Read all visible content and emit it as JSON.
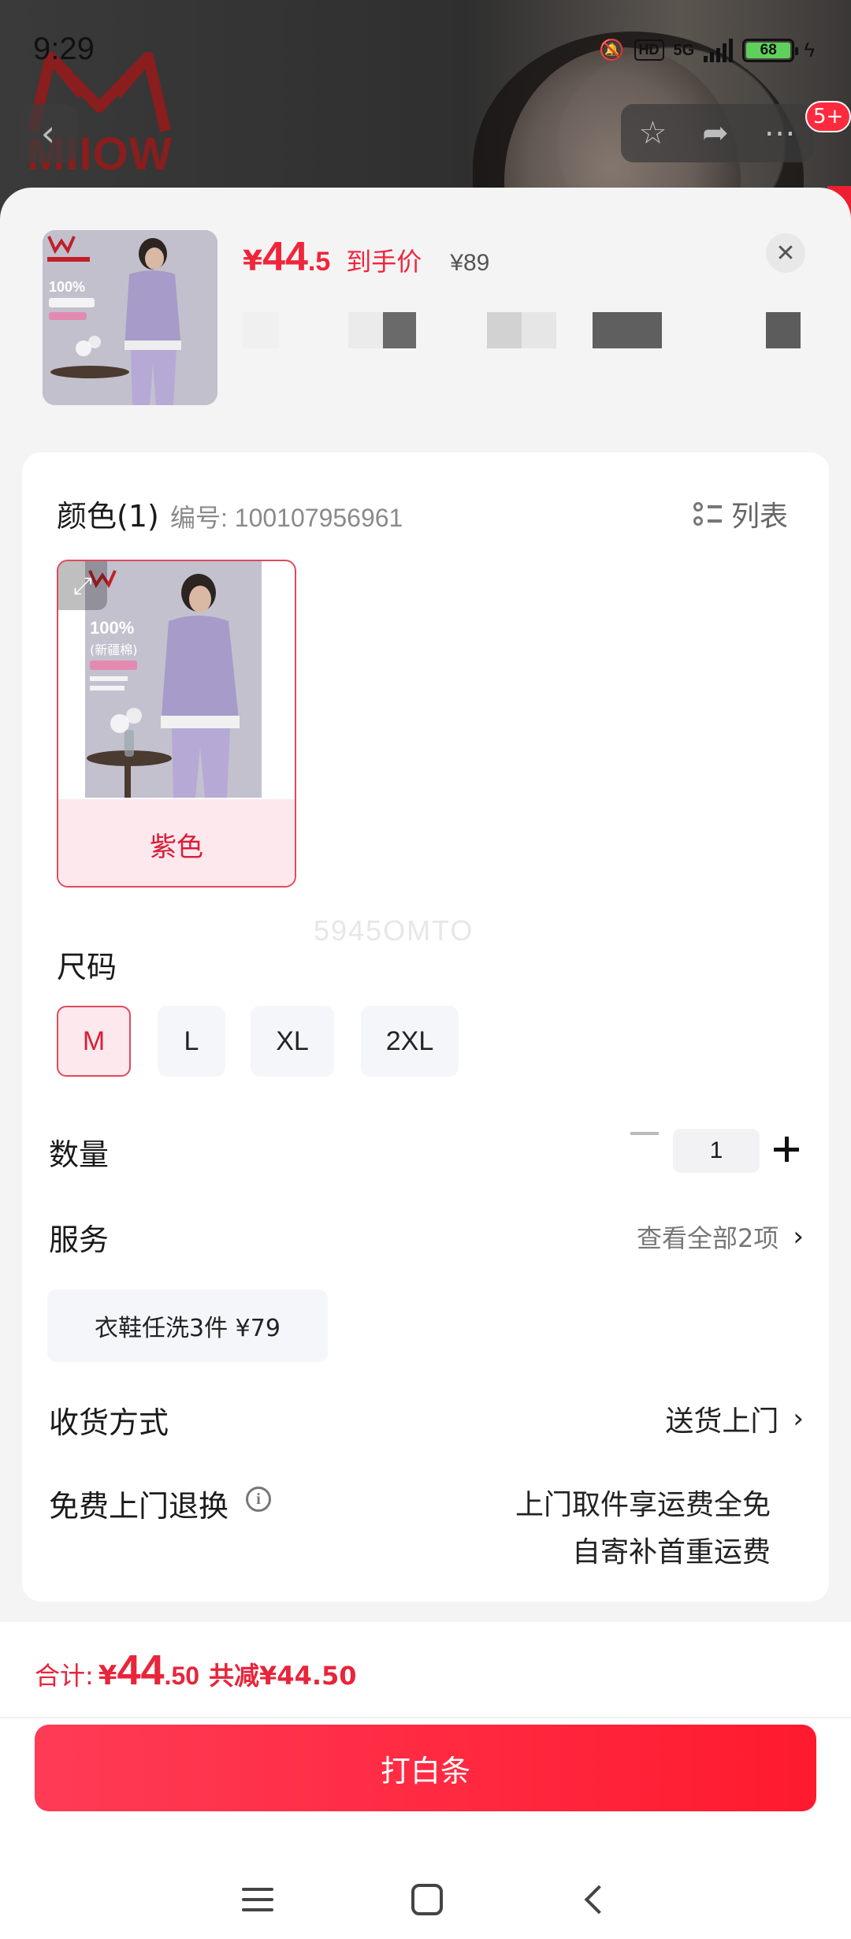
{
  "status_bar": {
    "time": "9:29",
    "hd": "HD",
    "network": "5G",
    "battery_level": "68",
    "battery_color": "#5fd15a"
  },
  "brand": {
    "word": "MIIOW"
  },
  "header": {
    "back_icon": "chevron-left-icon",
    "actions": [
      "star-icon",
      "share-icon",
      "more-icon"
    ],
    "badge": "5+"
  },
  "product": {
    "price_symbol": "¥",
    "price_int": "44",
    "price_dec": ".5",
    "price_label": "到手价",
    "original_price": "¥89"
  },
  "color": {
    "title": "颜色(1)",
    "code": "编号: 100107956961",
    "view_toggle": "列表",
    "options": [
      {
        "label": "紫色",
        "selected": true
      }
    ]
  },
  "watermark": "5945OMTO",
  "size": {
    "title": "尺码",
    "options": [
      {
        "label": "M",
        "selected": true
      },
      {
        "label": "L",
        "selected": false
      },
      {
        "label": "XL",
        "selected": false
      },
      {
        "label": "2XL",
        "selected": false
      }
    ]
  },
  "quantity": {
    "title": "数量",
    "value": "1"
  },
  "service": {
    "title": "服务",
    "view_all": "查看全部2项",
    "chip": "衣鞋任洗3件  ¥79"
  },
  "delivery": {
    "title": "收货方式",
    "value": "送货上门"
  },
  "returns": {
    "title": "免费上门退换",
    "line1": "上门取件享运费全免",
    "line2": "自寄补首重运费"
  },
  "footer": {
    "total_label": "合计:",
    "total_symbol": "¥",
    "total_int": "44",
    "total_dec": ".50",
    "savings": "共减¥44.50",
    "cta": "打白条",
    "accent": "#f0253c"
  }
}
